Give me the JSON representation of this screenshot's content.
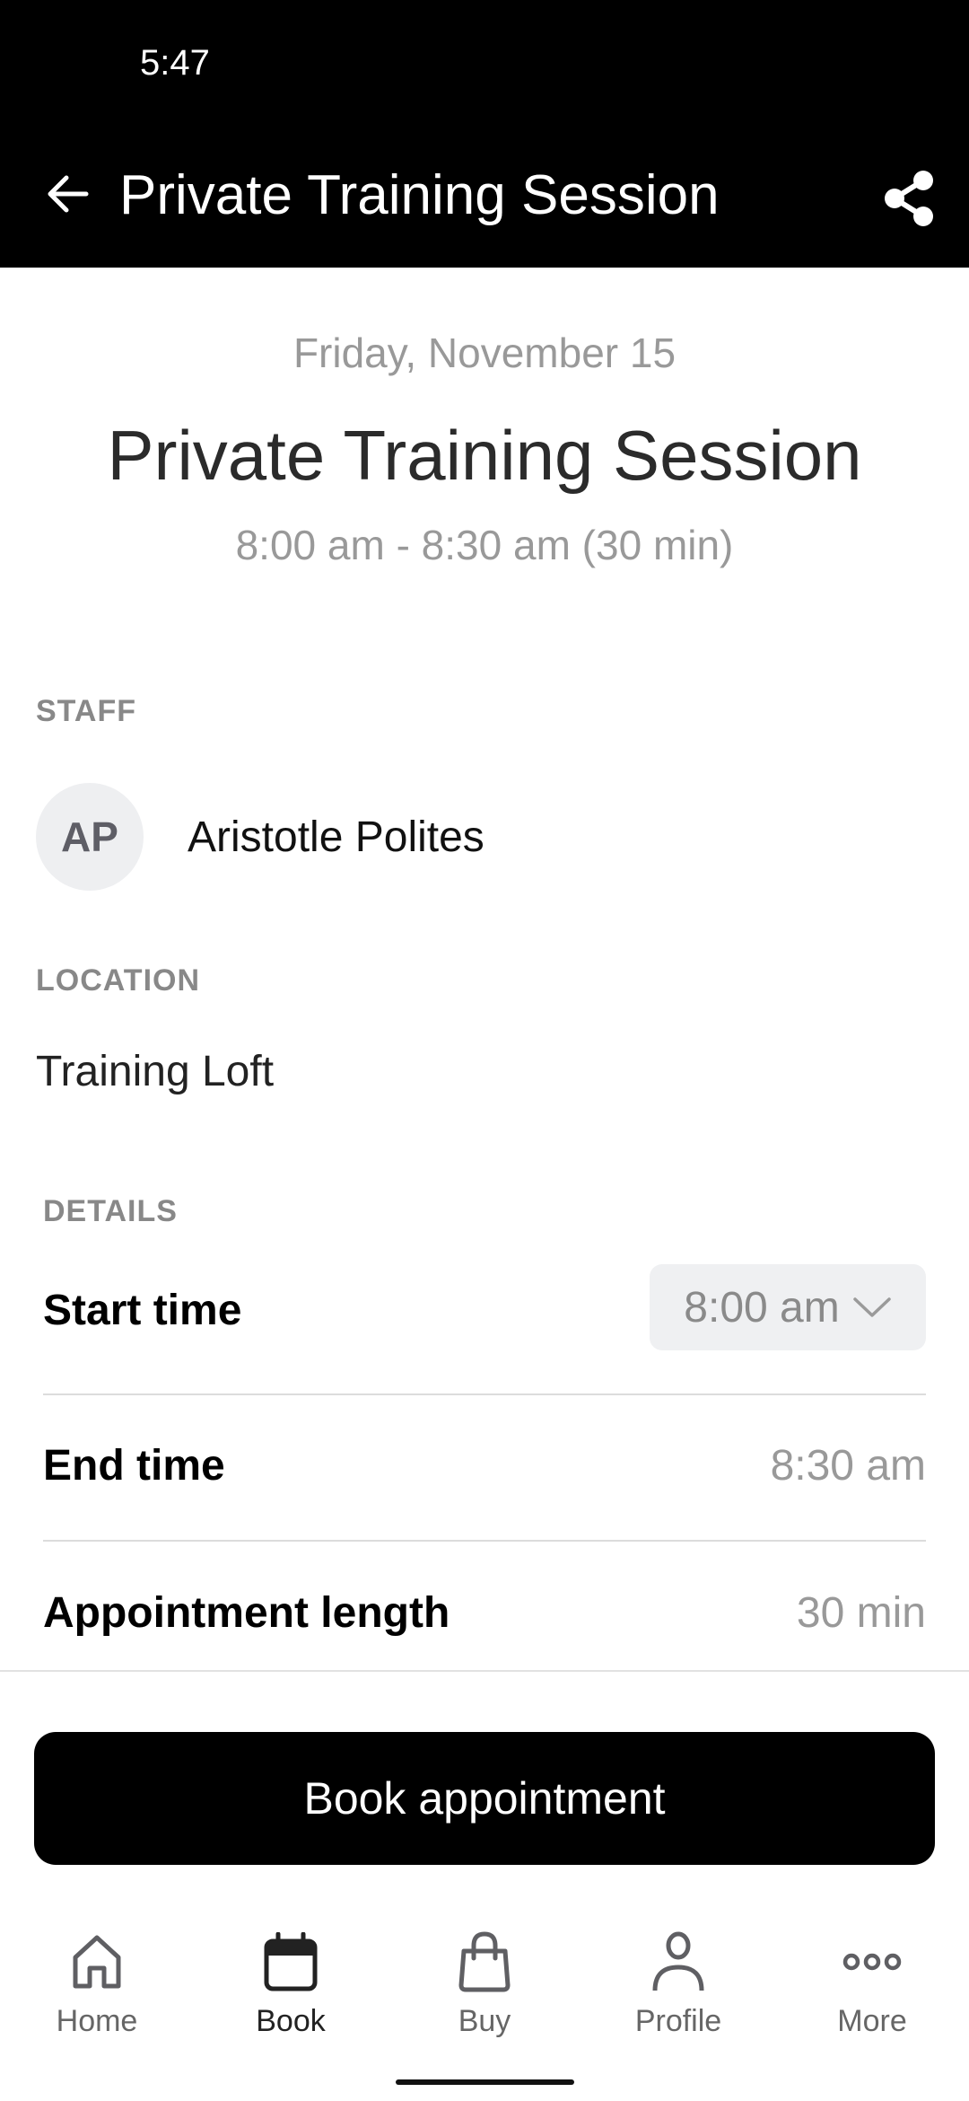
{
  "status_bar": {
    "time": "5:47"
  },
  "app_bar": {
    "title": "Private Training Session",
    "back_icon": "arrow-left-icon",
    "share_icon": "share-icon"
  },
  "hero": {
    "date": "Friday, November 15",
    "title": "Private Training Session",
    "time_range": "8:00 am - 8:30 am (30 min)"
  },
  "staff": {
    "label": "STAFF",
    "initials": "AP",
    "name": "Aristotle Polites"
  },
  "location": {
    "label": "LOCATION",
    "name": "Training Loft"
  },
  "details": {
    "label": "DETAILS",
    "rows": [
      {
        "label": "Start time",
        "value": "8:00 am",
        "type": "select"
      },
      {
        "label": "End time",
        "value": "8:30 am"
      },
      {
        "label": "Appointment length",
        "value": "30 min"
      }
    ]
  },
  "actions": {
    "book_label": "Book appointment"
  },
  "bottom_nav": {
    "items": [
      {
        "label": "Home",
        "icon": "home-icon",
        "active": false
      },
      {
        "label": "Book",
        "icon": "calendar-icon",
        "active": true
      },
      {
        "label": "Buy",
        "icon": "shopping-bag-icon",
        "active": false
      },
      {
        "label": "Profile",
        "icon": "person-icon",
        "active": false
      },
      {
        "label": "More",
        "icon": "more-dots-icon",
        "active": false
      }
    ]
  },
  "colors": {
    "header_bg": "#000000",
    "primary_button": "#000000",
    "muted_text": "#999999",
    "select_bg": "#eff0f2"
  }
}
